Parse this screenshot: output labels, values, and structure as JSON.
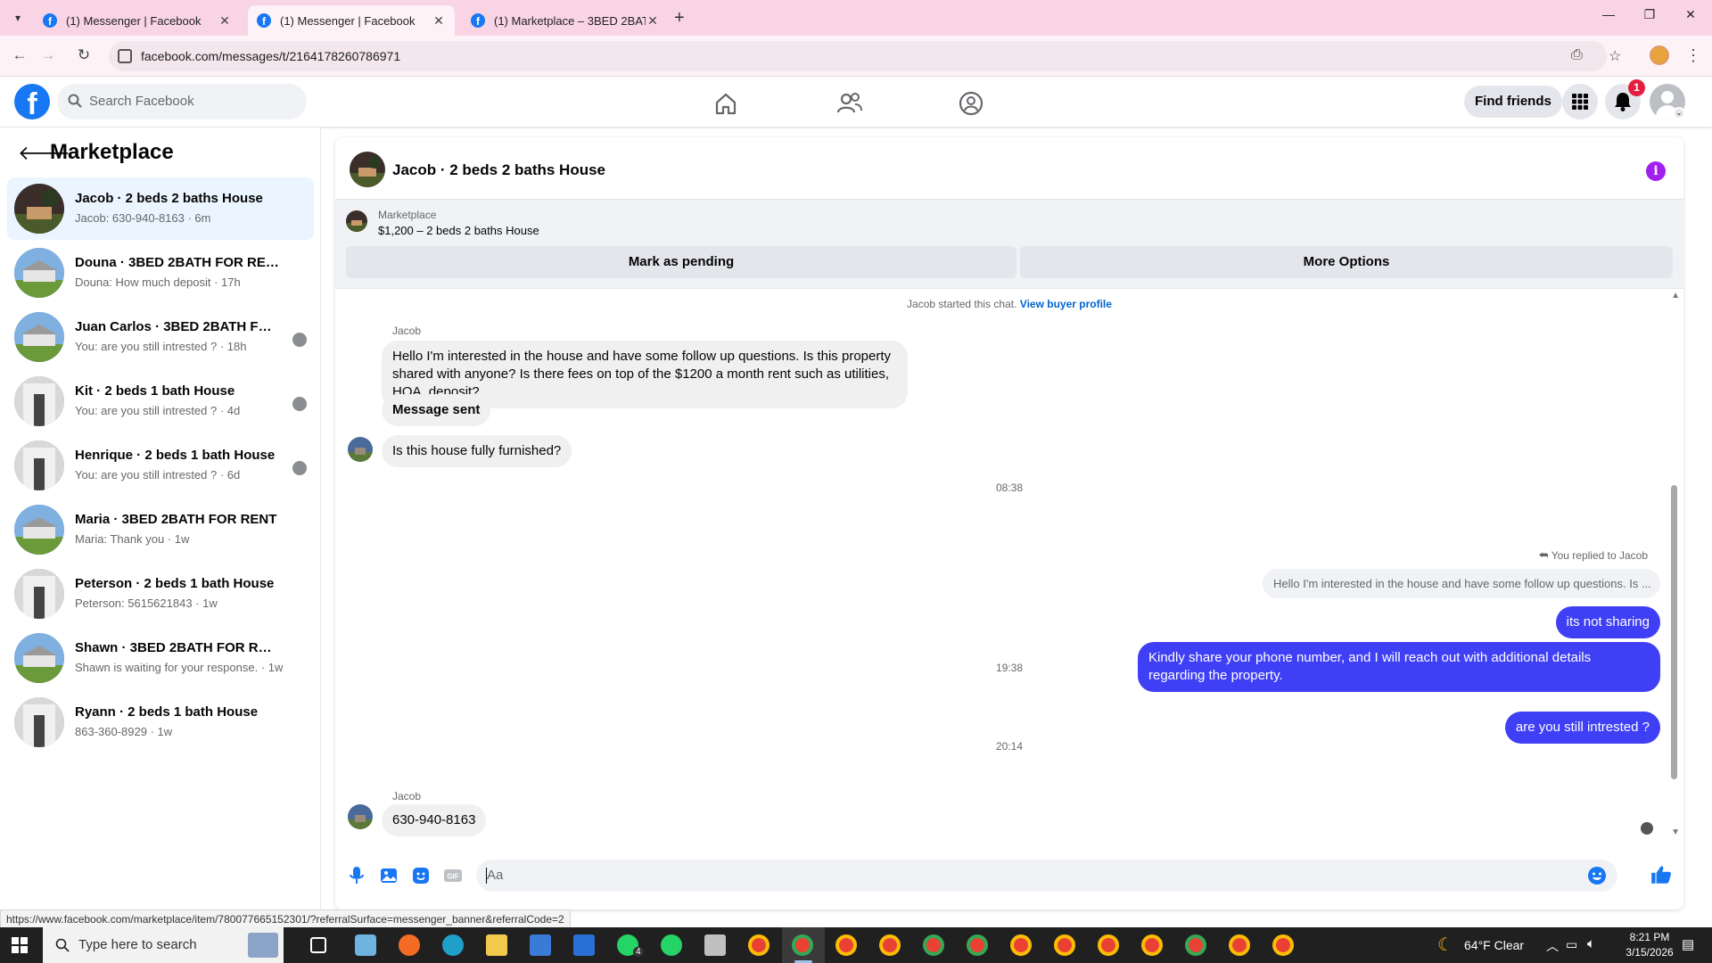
{
  "browser": {
    "tabs": [
      {
        "title": "(1) Messenger | Facebook",
        "active": false
      },
      {
        "title": "(1) Messenger | Facebook",
        "active": true
      },
      {
        "title": "(1) Marketplace – 3BED 2BATH",
        "active": false
      }
    ],
    "url": "facebook.com/messages/t/2164178260786971",
    "status_url": "https://www.facebook.com/marketplace/item/780077665152301/?referralSurface=messenger_banner&referralCode=2"
  },
  "fb_header": {
    "search_placeholder": "Search Facebook",
    "find_friends": "Find friends",
    "notification_count": "1"
  },
  "sidebar": {
    "title": "Marketplace",
    "conversations": [
      {
        "name": "Jacob · 2 beds 2 baths House",
        "preview": "Jacob: 630-940-8163 · 6m",
        "active": true
      },
      {
        "name": "Douna · 3BED 2BATH FOR RENT",
        "preview": "Douna: How much deposit · 17h"
      },
      {
        "name": "Juan Carlos · 3BED 2BATH FOR ...",
        "preview": "You: are you still intrested ? · 18h"
      },
      {
        "name": "Kit · 2 beds 1 bath House",
        "preview": "You: are you still intrested ? · 4d"
      },
      {
        "name": "Henrique · 2 beds 1 bath House",
        "preview": "You: are you still intrested ? · 6d"
      },
      {
        "name": "Maria · 3BED 2BATH FOR RENT",
        "preview": "Maria: Thank you · 1w"
      },
      {
        "name": "Peterson · 2 beds 1 bath House",
        "preview": "Peterson: 5615621843 · 1w"
      },
      {
        "name": "Shawn · 3BED 2BATH FOR RENT",
        "preview": "Shawn is waiting for your response. · 1w"
      },
      {
        "name": "Ryann · 2 beds 1 bath House",
        "preview": "863-360-8929 · 1w"
      }
    ]
  },
  "chat": {
    "title": "Jacob · 2 beds 2 baths House",
    "banner": {
      "caption": "Marketplace",
      "listing": "$1,200 – 2 beds 2 baths House",
      "mark_pending": "Mark as pending",
      "more_options": "More Options"
    },
    "system_note": "Jacob started this chat.",
    "system_link": "View buyer profile",
    "sender_name": "Jacob",
    "incoming_1": "Hello I'm interested in the house and have some follow up questions. Is this property shared with anyone? Is there fees on top of the $1200 a month rent such as utilities, HOA, deposit?",
    "incoming_2": "Message sent",
    "incoming_3": "Is this house fully furnished?",
    "time_1": "08:38",
    "replied_label": "You replied to Jacob",
    "reply_quote": "Hello I'm interested in the house and have some follow up questions. Is ...",
    "outgoing_1": "its not sharing",
    "outgoing_2": "Kindly share your phone number, and I will reach out with additional details regarding the property.",
    "time_2": "19:38",
    "outgoing_3": "are you still intrested ?",
    "time_3": "20:14",
    "incoming_4": "630-940-8163",
    "composer_placeholder": "Aa"
  },
  "taskbar": {
    "search_placeholder": "Type here to search",
    "whatsapp_badge": "4",
    "weather": "64°F  Clear",
    "time": "8:21 PM",
    "date": "3/15/2026"
  },
  "colors": {
    "fb_blue": "#1877f2",
    "outgoing_bubble": "#3f3ff6",
    "tab_bar": "#f9d4e4",
    "info_icon": "#a020f0"
  }
}
